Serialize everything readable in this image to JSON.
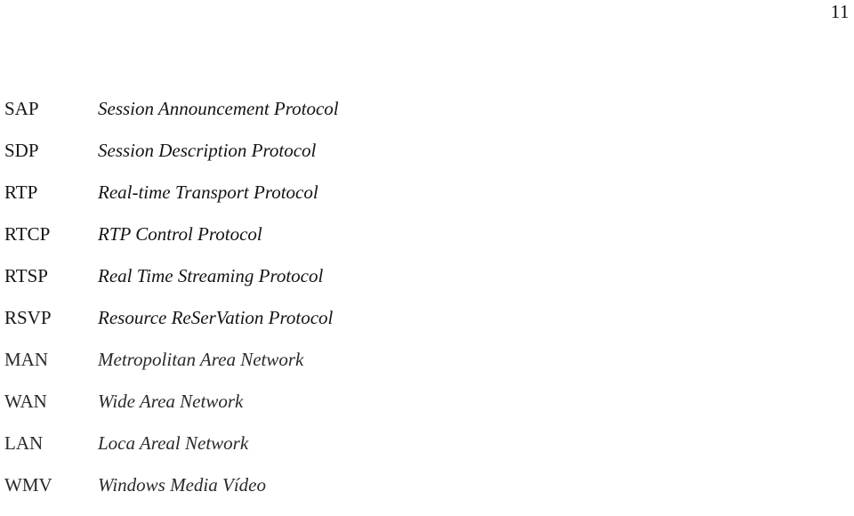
{
  "page": {
    "number": "11"
  },
  "glossary": {
    "entries": [
      {
        "abbr": "SAP",
        "definition": "Session Announcement Protocol"
      },
      {
        "abbr": "SDP",
        "definition": "Session Description Protocol"
      },
      {
        "abbr": "RTP",
        "definition": "Real-time Transport Protocol"
      },
      {
        "abbr": "RTCP",
        "definition": "RTP Control Protocol"
      },
      {
        "abbr": "RTSP",
        "definition": "Real Time Streaming Protocol"
      },
      {
        "abbr": "RSVP",
        "definition": "Resource ReSerVation Protocol"
      },
      {
        "abbr": "MAN",
        "definition": "Metropolitan Area Network"
      },
      {
        "abbr": "WAN",
        "definition": "Wide Area Network"
      },
      {
        "abbr": "LAN",
        "definition": "Loca Areal Network"
      },
      {
        "abbr": "WMV",
        "definition": "Windows Media Vídeo"
      }
    ]
  }
}
